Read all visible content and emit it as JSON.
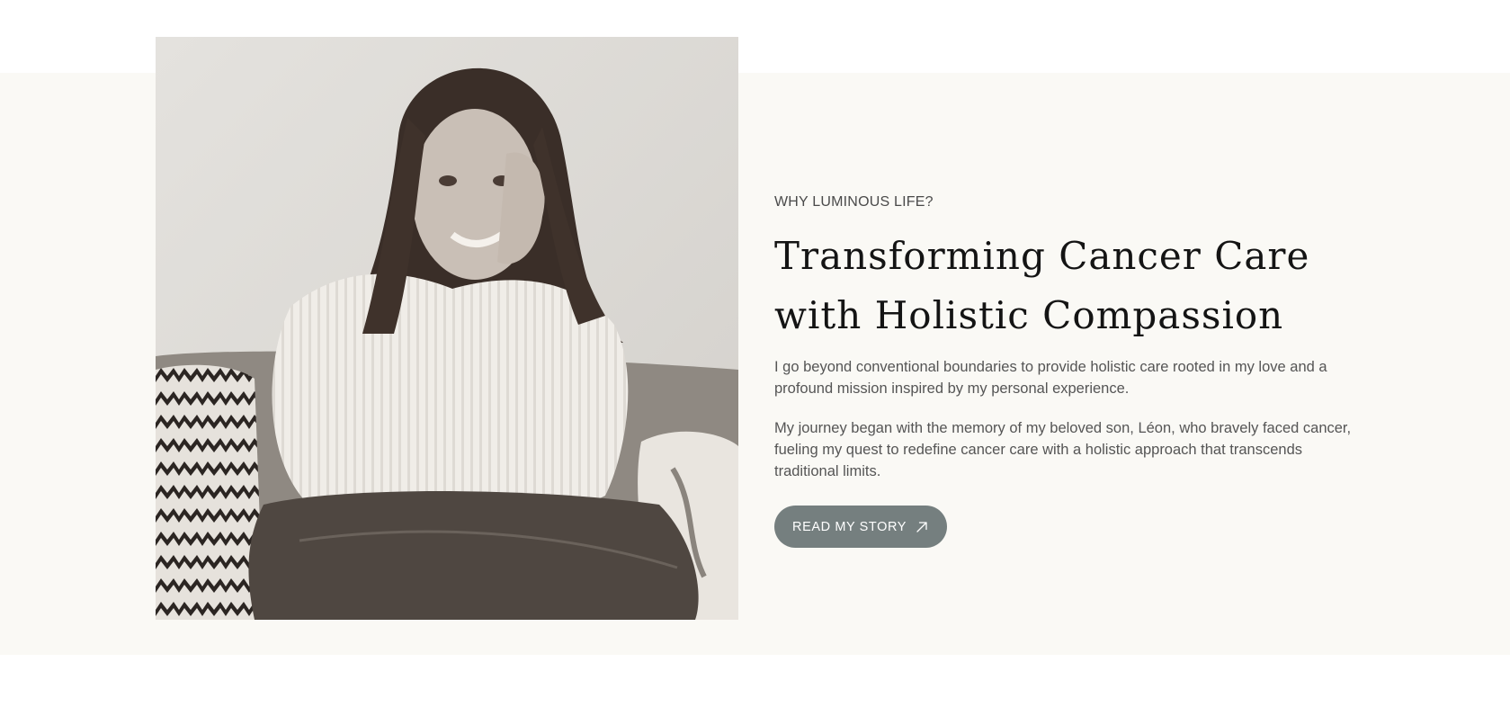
{
  "section": {
    "eyebrow": "WHY LUMINOUS LIFE?",
    "heading_line1": "Transforming Cancer Care",
    "heading_line2": "with Holistic Compassion",
    "paragraph1": "I go beyond conventional boundaries to provide holistic care rooted in my love and a profound mission inspired by my personal experience.",
    "paragraph2": "My journey began with the memory of my beloved son, Léon, who bravely faced cancer, fueling my quest to redefine cancer care with a holistic approach that transcends traditional limits.",
    "button_label": "READ MY STORY",
    "button_icon": "arrow-up-right-icon"
  },
  "colors": {
    "band_background": "#faf9f5",
    "button_background": "#757f7f",
    "heading_text": "#141414",
    "body_text": "#555555"
  }
}
